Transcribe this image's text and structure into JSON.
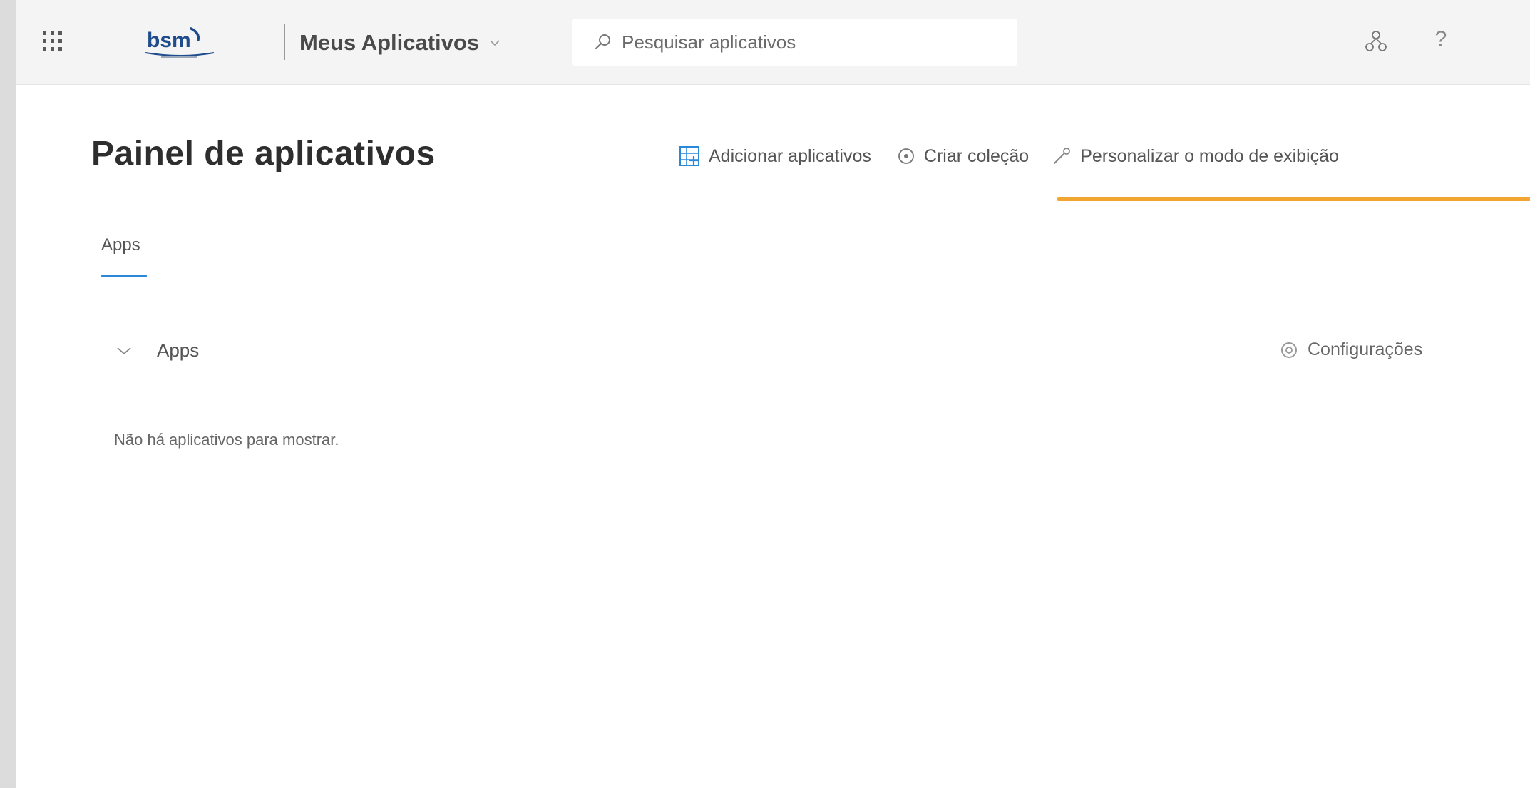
{
  "topbar": {
    "app_name": "Meus Aplicativos",
    "search_placeholder": "Pesquisar aplicativos",
    "help_label": "?",
    "logo_text": "bsm"
  },
  "page": {
    "title": "Painel de aplicativos",
    "commands": {
      "add_apps": "Adicionar aplicativos",
      "create_collection": "Criar coleção",
      "customize_view": "Personalizar o modo de exibição"
    }
  },
  "tabs": [
    {
      "label": "Apps",
      "active": true
    }
  ],
  "section": {
    "title": "Apps",
    "settings_label": "Configurações",
    "empty_message": "Não há aplicativos para mostrar."
  },
  "colors": {
    "accent_tab": "#2b88d8",
    "highlight": "#f2a530",
    "logo_blue": "#1e4c8c"
  }
}
